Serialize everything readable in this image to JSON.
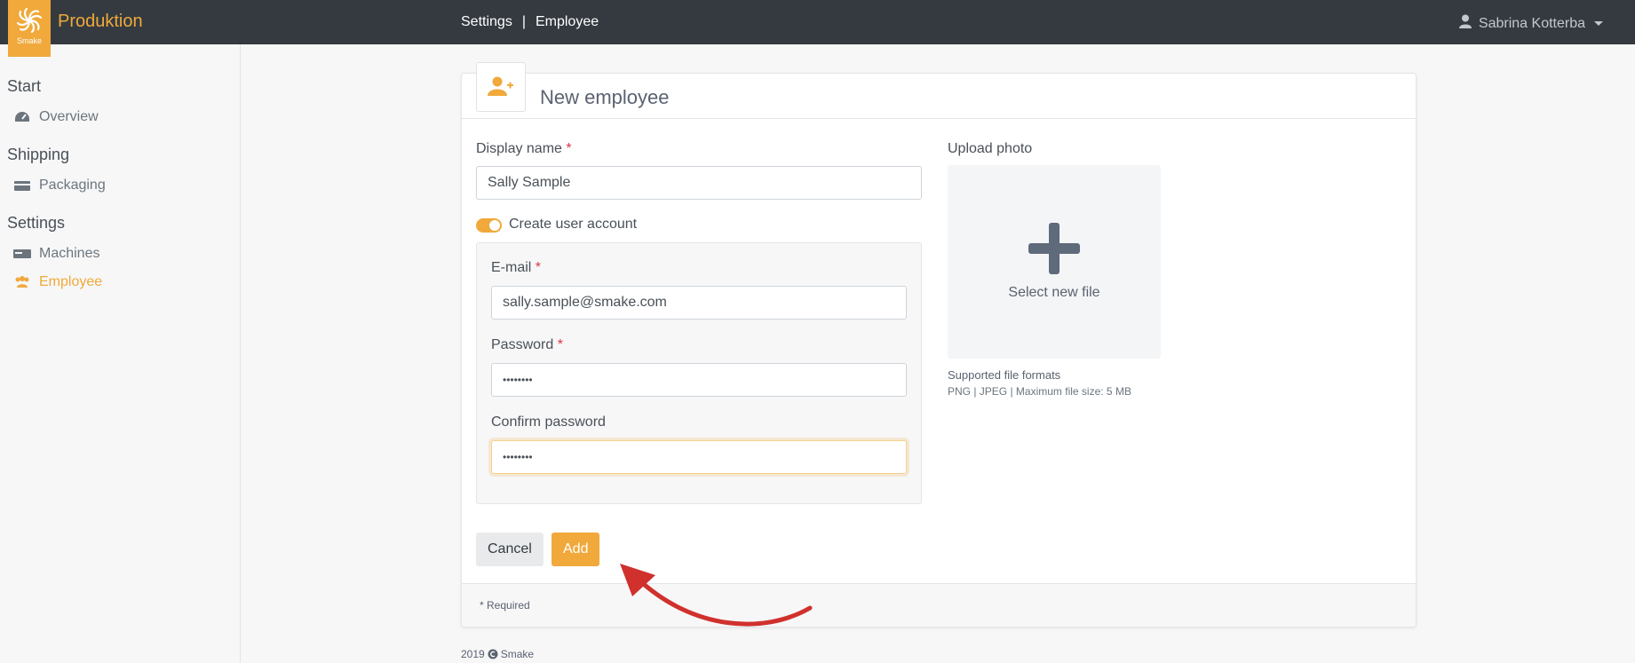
{
  "app": {
    "logo_text": "Smake",
    "title": "Produktion"
  },
  "breadcrumb": {
    "items": [
      "Settings",
      "|",
      "Employee"
    ]
  },
  "user": {
    "name": "Sabrina Kotterba"
  },
  "sidebar": {
    "sections": [
      {
        "title": "Start",
        "items": [
          {
            "label": "Overview",
            "icon": "dashboard-icon"
          }
        ]
      },
      {
        "title": "Shipping",
        "items": [
          {
            "label": "Packaging",
            "icon": "boxes-icon"
          }
        ]
      },
      {
        "title": "Settings",
        "items": [
          {
            "label": "Machines",
            "icon": "machine-icon"
          },
          {
            "label": "Employee",
            "icon": "users-icon",
            "active": true
          }
        ]
      }
    ]
  },
  "form": {
    "title": "New employee",
    "display_name_label": "Display name",
    "display_name_value": "Sally Sample",
    "required_mark": "*",
    "create_account_label": "Create user account",
    "create_account_enabled": true,
    "email_label": "E-mail",
    "email_value": "sally.sample@smake.com",
    "password_label": "Password",
    "password_value": "••••••••",
    "confirm_password_label": "Confirm password",
    "confirm_password_value": "••••••••",
    "upload_label": "Upload photo",
    "upload_button": "Select new file",
    "formats_title": "Supported file formats",
    "formats_detail": "PNG | JPEG | Maximum file size: 5 MB",
    "cancel_label": "Cancel",
    "add_label": "Add",
    "required_note": "* Required"
  },
  "footer": {
    "year": "2019",
    "brand": "Smake"
  },
  "colors": {
    "accent": "#f0a93a",
    "topbar": "#343a40",
    "required": "#dc3545",
    "annotation_arrow": "#d0312d"
  }
}
